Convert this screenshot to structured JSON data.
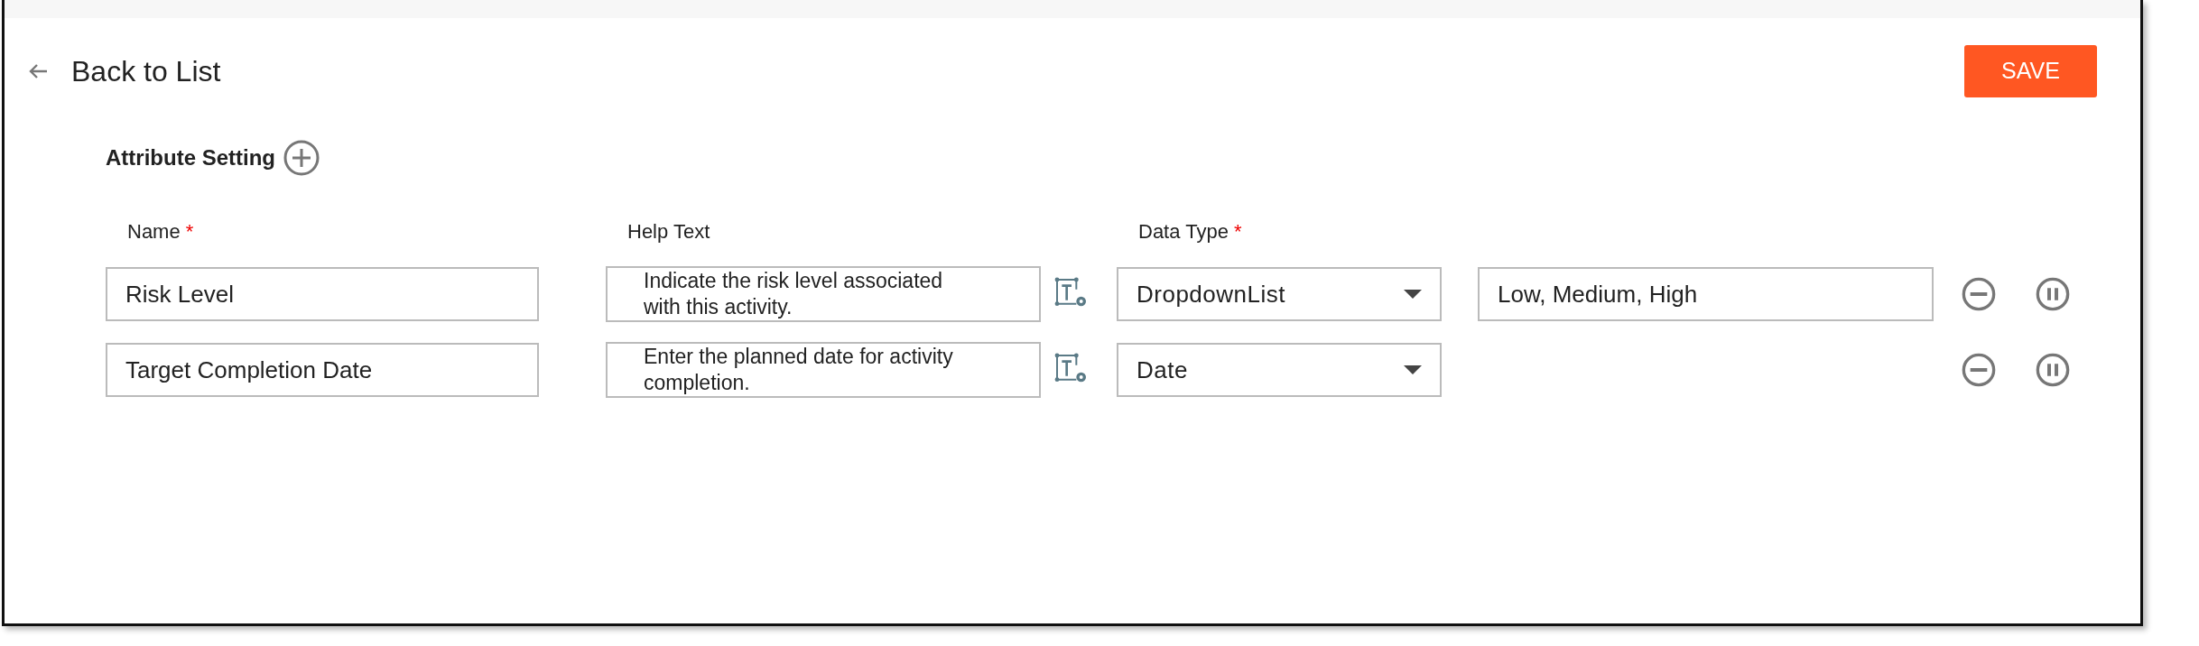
{
  "header": {
    "back_label": "Back to List",
    "save_button": "SAVE"
  },
  "section": {
    "title": "Attribute Setting"
  },
  "columns": [
    {
      "label": "Name",
      "required_mark": "*"
    },
    {
      "label": "Help Text"
    },
    {
      "label": "Data Type",
      "required_mark": "*"
    }
  ],
  "rows": [
    {
      "name": "Risk Level",
      "help_text": "Indicate the risk level associated with this activity.",
      "data_type": "DropdownList",
      "options": "Low, Medium, High"
    },
    {
      "name": "Target Completion Date",
      "help_text": "Enter the planned date for activity completion.",
      "data_type": "Date"
    }
  ]
}
